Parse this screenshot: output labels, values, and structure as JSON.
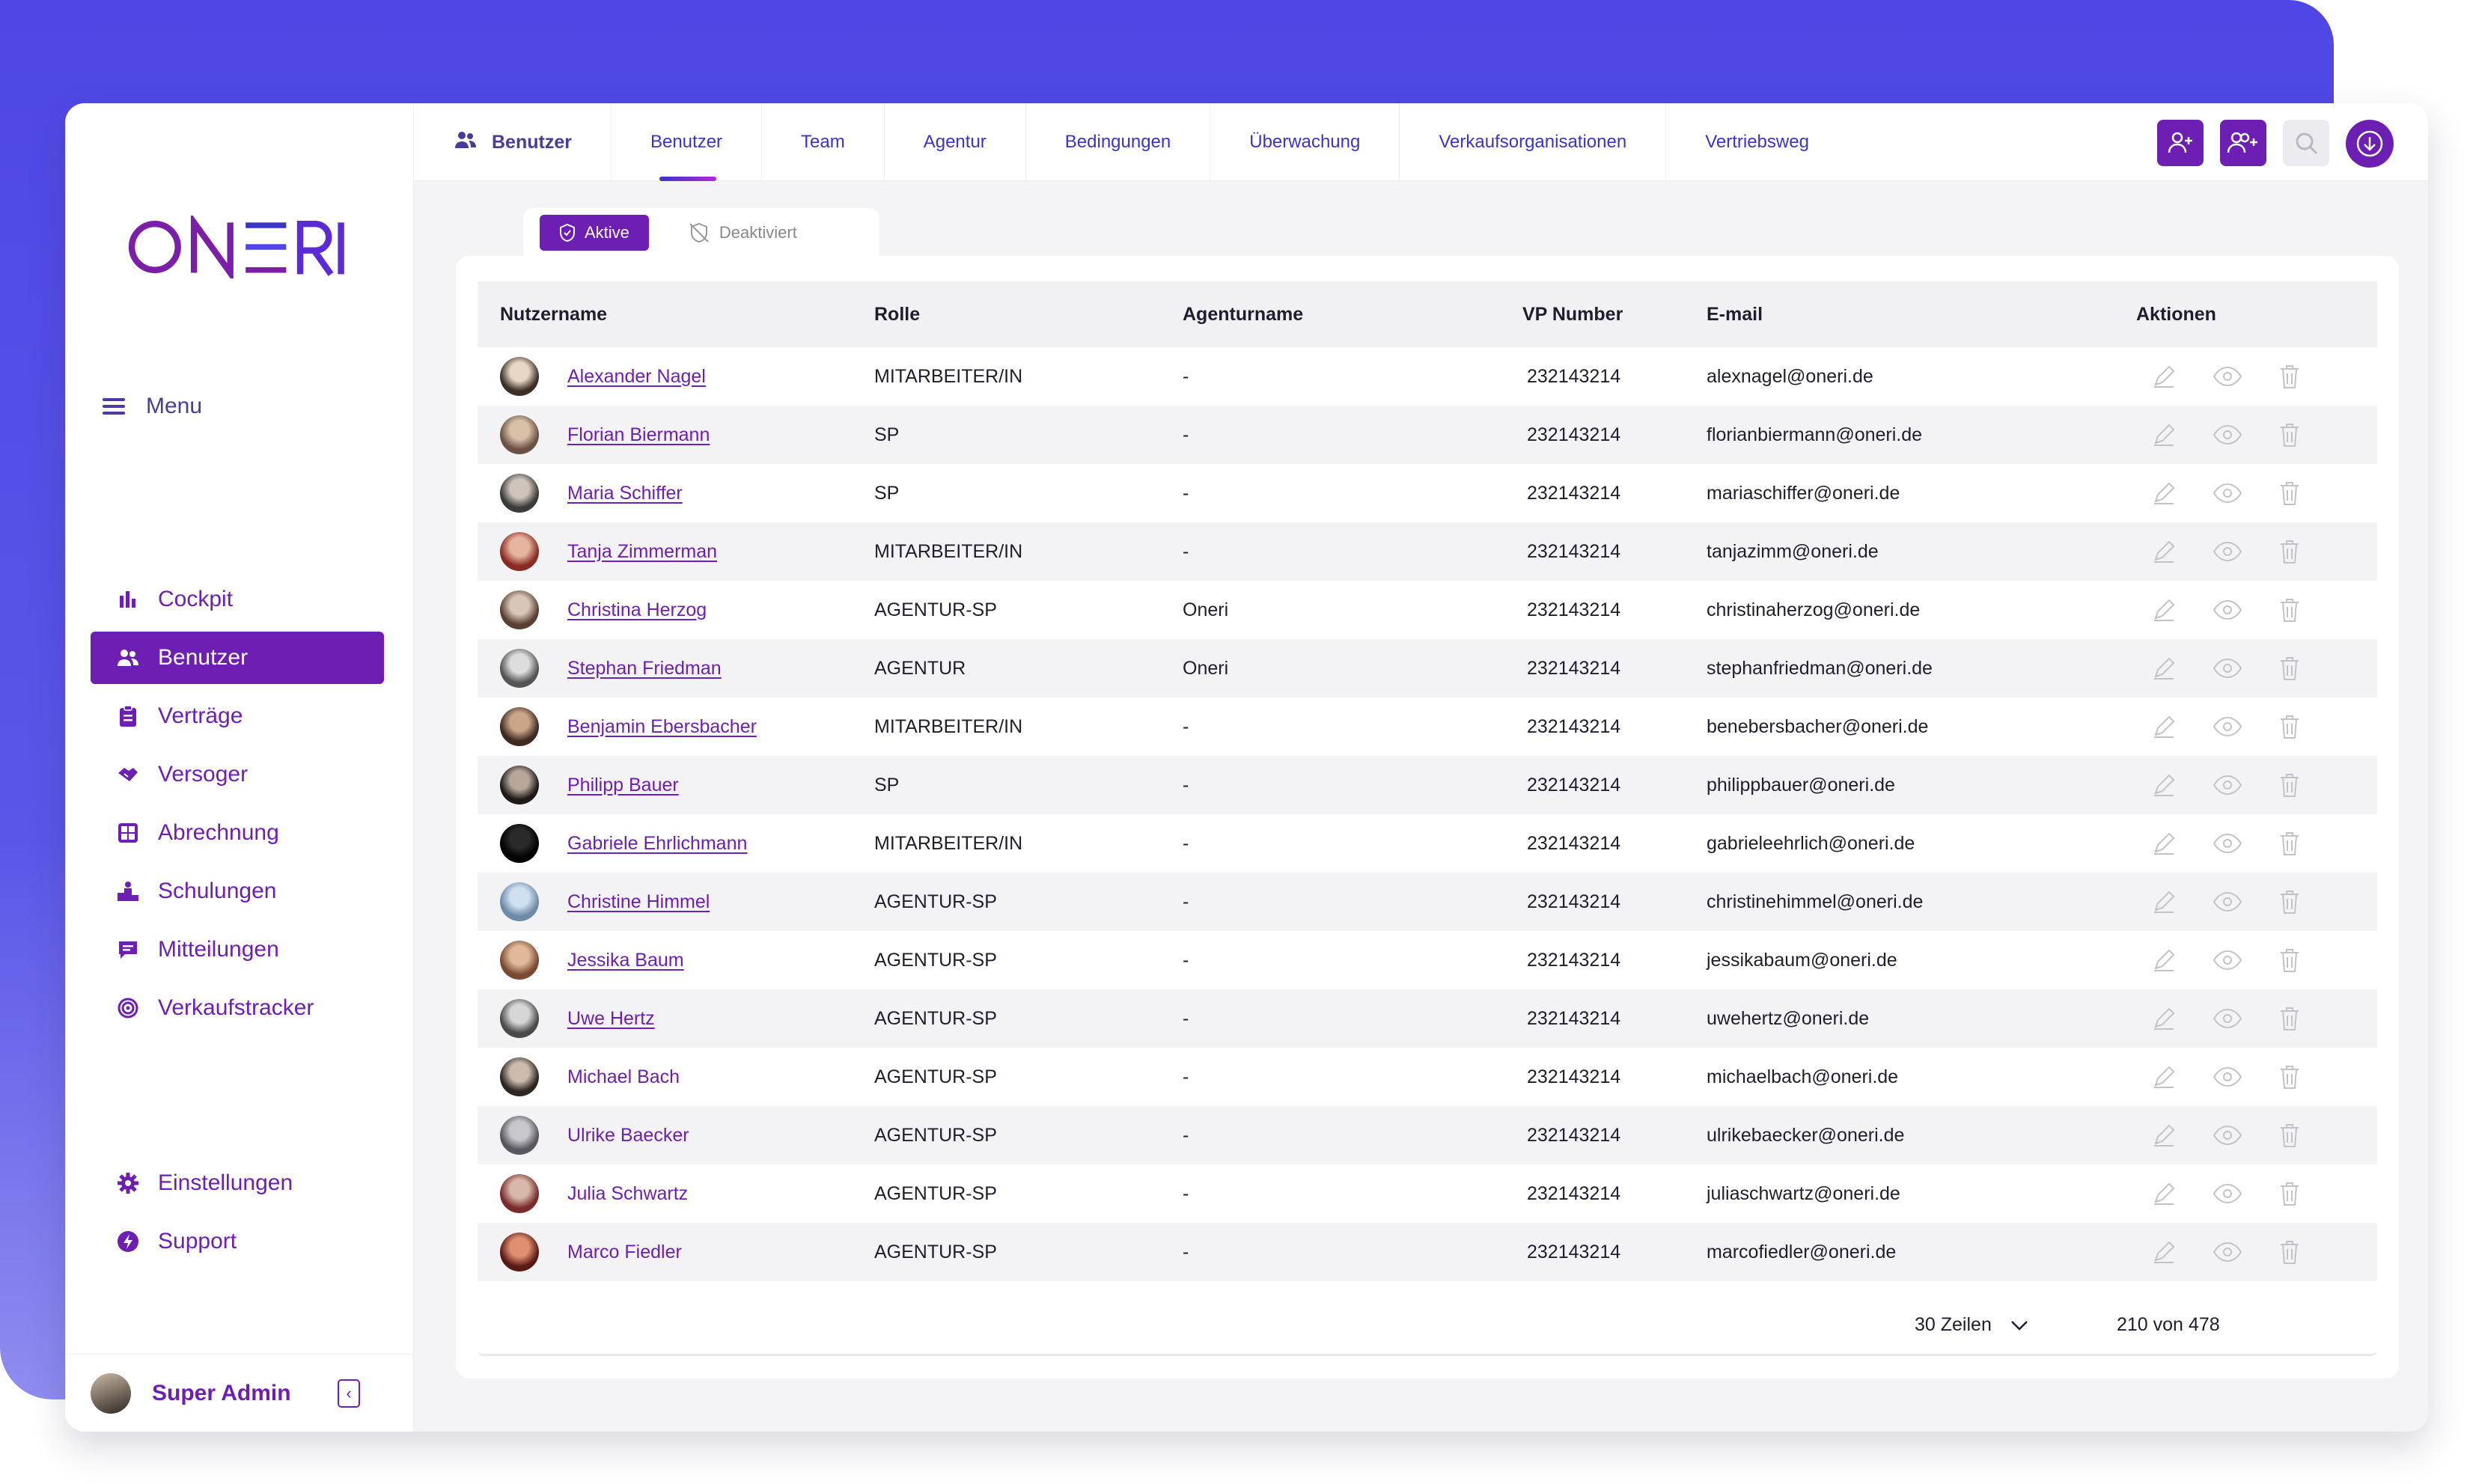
{
  "app": {
    "logo_text": "ONERI"
  },
  "sidebar": {
    "menu_label": "Menu",
    "items": [
      {
        "label": "Cockpit",
        "icon": "bar-chart-icon"
      },
      {
        "label": "Benutzer",
        "icon": "users-icon",
        "active": true
      },
      {
        "label": "Verträge",
        "icon": "clipboard-icon"
      },
      {
        "label": "Versoger",
        "icon": "handshake-icon"
      },
      {
        "label": "Abrechnung",
        "icon": "calculator-icon"
      },
      {
        "label": "Schulungen",
        "icon": "podium-icon"
      },
      {
        "label": "Mitteilungen",
        "icon": "message-icon"
      },
      {
        "label": "Verkaufstracker",
        "icon": "target-icon"
      }
    ],
    "bottom_items": [
      {
        "label": "Einstellungen",
        "icon": "gear-icon"
      },
      {
        "label": "Support",
        "icon": "lightning-icon"
      }
    ],
    "user": {
      "name": "Super Admin"
    }
  },
  "topnav": {
    "section_label": "Benutzer",
    "tabs": [
      "Benutzer",
      "Team",
      "Agentur",
      "Bedingungen",
      "Überwachung",
      "Verkaufsorganisationen",
      "Vertriebsweg"
    ],
    "selected_tab": "Benutzer"
  },
  "status_tabs": {
    "active": "Aktive",
    "inactive": "Deaktiviert"
  },
  "table": {
    "columns": [
      "Nutzername",
      "Rolle",
      "Agenturname",
      "VP Number",
      "E-mail",
      "Aktionen"
    ],
    "rows": [
      {
        "name": "Alexander Nagel",
        "role": "MITARBEITER/IN",
        "agency": "-",
        "vp": "232143214",
        "email": "alexnagel@oneri.de"
      },
      {
        "name": "Florian Biermann",
        "role": "SP",
        "agency": "-",
        "vp": "232143214",
        "email": "florianbiermann@oneri.de"
      },
      {
        "name": "Maria Schiffer",
        "role": "SP",
        "agency": "-",
        "vp": "232143214",
        "email": "mariaschiffer@oneri.de"
      },
      {
        "name": "Tanja Zimmerman",
        "role": "MITARBEITER/IN",
        "agency": "-",
        "vp": "232143214",
        "email": "tanjazimm@oneri.de"
      },
      {
        "name": "Christina Herzog",
        "role": "AGENTUR-SP",
        "agency": "Oneri",
        "vp": "232143214",
        "email": "christinaherzog@oneri.de"
      },
      {
        "name": "Stephan Friedman",
        "role": "AGENTUR",
        "agency": "Oneri",
        "vp": "232143214",
        "email": "stephanfriedman@oneri.de"
      },
      {
        "name": "Benjamin Ebersbacher",
        "role": "MITARBEITER/IN",
        "agency": "-",
        "vp": "232143214",
        "email": "benebersbacher@oneri.de"
      },
      {
        "name": "Philipp Bauer",
        "role": "SP",
        "agency": "-",
        "vp": "232143214",
        "email": "philippbauer@oneri.de"
      },
      {
        "name": "Gabriele Ehrlichmann",
        "role": "MITARBEITER/IN",
        "agency": "-",
        "vp": "232143214",
        "email": "gabrieleehrlich@oneri.de"
      },
      {
        "name": "Christine Himmel",
        "role": "AGENTUR-SP",
        "agency": "-",
        "vp": "232143214",
        "email": "christinehimmel@oneri.de"
      },
      {
        "name": "Jessika Baum",
        "role": "AGENTUR-SP",
        "agency": "-",
        "vp": "232143214",
        "email": "jessikabaum@oneri.de"
      },
      {
        "name": "Uwe Hertz",
        "role": "AGENTUR-SP",
        "agency": "-",
        "vp": "232143214",
        "email": "uwehertz@oneri.de"
      },
      {
        "name": "Michael Bach",
        "role": "AGENTUR-SP",
        "agency": "-",
        "vp": "232143214",
        "email": "michaelbach@oneri.de"
      },
      {
        "name": "Ulrike Baecker",
        "role": "AGENTUR-SP",
        "agency": "-",
        "vp": "232143214",
        "email": "ulrikebaecker@oneri.de"
      },
      {
        "name": "Julia Schwartz",
        "role": "AGENTUR-SP",
        "agency": "-",
        "vp": "232143214",
        "email": "juliaschwartz@oneri.de"
      },
      {
        "name": "Marco Fiedler",
        "role": "AGENTUR-SP",
        "agency": "-",
        "vp": "232143214",
        "email": "marcofiedler@oneri.de"
      }
    ],
    "row_actions": [
      "edit-icon",
      "view-icon",
      "delete-icon"
    ]
  },
  "pagination": {
    "rows_label": "30 Zeilen",
    "range": "210 von 478"
  },
  "colors": {
    "primary": "#6d1fb3",
    "accent": "#4f46e5",
    "link": "#3a34c7"
  }
}
